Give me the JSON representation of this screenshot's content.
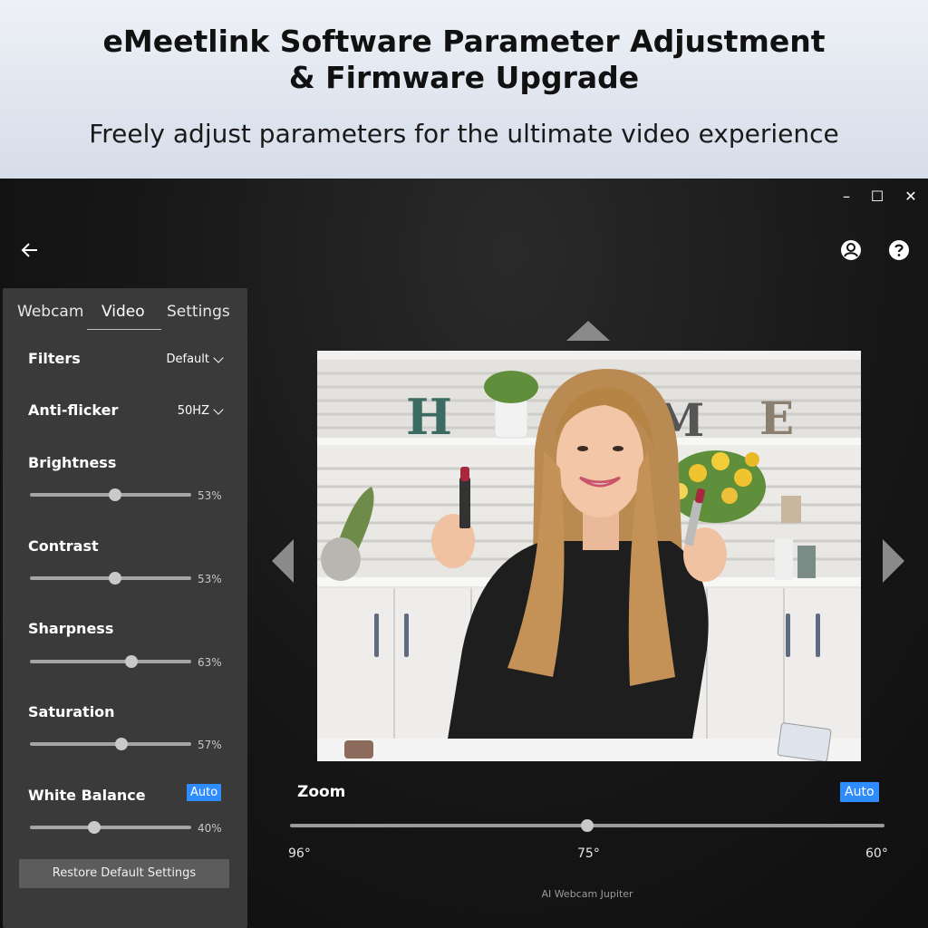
{
  "banner": {
    "title_line1": "eMeetlink Software Parameter Adjustment",
    "title_line2": "& Firmware Upgrade",
    "subtitle": "Freely adjust parameters for the ultimate video experience"
  },
  "window_controls": {
    "minimize": "–",
    "maximize": "☐",
    "close": "✕"
  },
  "tabs": [
    {
      "label": "Webcam",
      "active": false
    },
    {
      "label": "Video",
      "active": true
    },
    {
      "label": "Settings",
      "active": false
    }
  ],
  "filters": {
    "label": "Filters",
    "value": "Default"
  },
  "anti_flicker": {
    "label": "Anti-flicker",
    "value": "50HZ"
  },
  "sliders": [
    {
      "label": "Brightness",
      "value_text": "53%",
      "value": 53
    },
    {
      "label": "Contrast",
      "value_text": "53%",
      "value": 53
    },
    {
      "label": "Sharpness",
      "value_text": "63%",
      "value": 63
    },
    {
      "label": "Saturation",
      "value_text": "57%",
      "value": 57
    },
    {
      "label": "White Balance",
      "value_text": "40%",
      "value": 40,
      "badge": "Auto"
    }
  ],
  "restore_button": "Restore Default Settings",
  "zoom": {
    "label": "Zoom",
    "badge": "Auto",
    "level": 0.5,
    "ticks": [
      "96°",
      "75°",
      "60°"
    ]
  },
  "device_name": "AI Webcam Jupiter",
  "colors": {
    "accent": "#2f8cff",
    "panel": "#3a3a3a",
    "background": "#141414"
  },
  "icons": [
    "back-arrow-icon",
    "user-icon",
    "help-icon",
    "up-arrow-icon",
    "left-arrow-icon",
    "right-arrow-icon",
    "chevron-down-icon"
  ]
}
